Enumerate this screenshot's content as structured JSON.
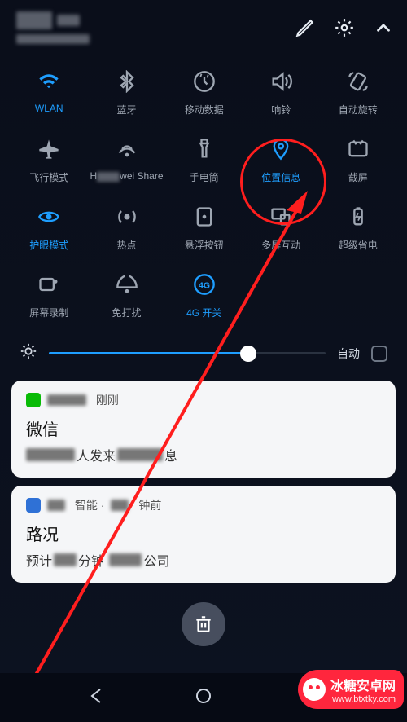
{
  "header": {
    "settings_icon": "gear",
    "edit_icon": "pencil",
    "collapse_icon": "chevron-up"
  },
  "quick_settings": {
    "rows": [
      [
        {
          "id": "wlan",
          "label": "WLAN",
          "icon": "wifi",
          "active": true
        },
        {
          "id": "bluetooth",
          "label": "蓝牙",
          "icon": "bluetooth",
          "active": false
        },
        {
          "id": "mobile-data",
          "label": "移动数据",
          "icon": "data",
          "active": false
        },
        {
          "id": "ring",
          "label": "响铃",
          "icon": "sound",
          "active": false
        },
        {
          "id": "auto-rotate",
          "label": "自动旋转",
          "icon": "rotate",
          "active": false
        }
      ],
      [
        {
          "id": "airplane",
          "label": "飞行模式",
          "icon": "airplane",
          "active": false
        },
        {
          "id": "huawei-share",
          "label": "H▮wei Share",
          "icon": "share",
          "active": false,
          "blur_label": true
        },
        {
          "id": "flashlight",
          "label": "手电筒",
          "icon": "flashlight",
          "active": false
        },
        {
          "id": "location",
          "label": "位置信息",
          "icon": "location",
          "active": true,
          "highlighted": true
        },
        {
          "id": "screenshot",
          "label": "截屏",
          "icon": "screenshot",
          "active": false
        }
      ],
      [
        {
          "id": "eye-comfort",
          "label": "护眼模式",
          "icon": "eye",
          "active": true
        },
        {
          "id": "hotspot",
          "label": "热点",
          "icon": "hotspot",
          "active": false
        },
        {
          "id": "float-button",
          "label": "悬浮按钮",
          "icon": "float",
          "active": false
        },
        {
          "id": "multi-screen",
          "label": "多屏互动",
          "icon": "multiscreen",
          "active": false
        },
        {
          "id": "super-save",
          "label": "超级省电",
          "icon": "battery",
          "active": false
        }
      ],
      [
        {
          "id": "screen-record",
          "label": "屏幕录制",
          "icon": "record",
          "active": false
        },
        {
          "id": "dnd",
          "label": "免打扰",
          "icon": "dnd",
          "active": false
        },
        {
          "id": "4g-switch",
          "label": "4G 开关",
          "icon": "fourg",
          "active": true
        }
      ]
    ]
  },
  "brightness": {
    "percent": 72,
    "auto_label": "自动",
    "auto_checked": false
  },
  "notifications": [
    {
      "app_color": "green",
      "header_suffix": "刚刚",
      "title": "微信",
      "body_parts": [
        "",
        "人发来",
        "息"
      ]
    },
    {
      "app_color": "blue",
      "header_mid": "智能 · ",
      "header_suffix": "钟前",
      "title": "路况",
      "body_parts": [
        "预计",
        "分钟",
        "公司"
      ]
    }
  ],
  "clear_label": "clear-all",
  "nav": {
    "back": "back",
    "home": "home",
    "recent": "recent"
  },
  "watermark": {
    "brand": "冰糖安卓网",
    "url": "www.btxtky.com"
  },
  "colors": {
    "accent": "#1e9eff",
    "highlight": "#ff1e1e",
    "brand": "#ff263d"
  }
}
